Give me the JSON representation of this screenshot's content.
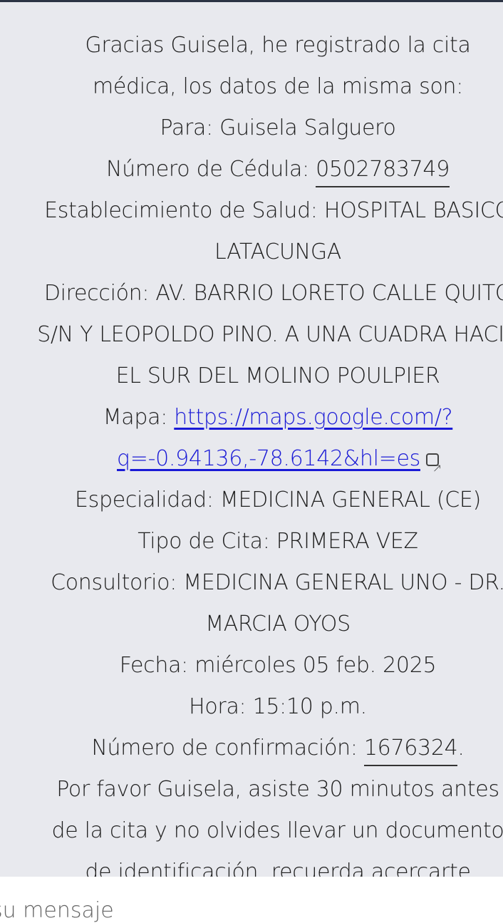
{
  "message": {
    "lines": [
      "Gracias Guisela, he registrado la cita",
      "médica, los datos de la misma son:",
      "Para: Guisela Salguero"
    ],
    "cedula_label": "Número de Cédula: ",
    "cedula_value": "0502783749",
    "lines2": [
      "Establecimiento de Salud: HOSPITAL BASICO",
      "LATACUNGA",
      "Dirección: AV. BARRIO LORETO CALLE QUITO",
      "S/N Y LEOPOLDO PINO. A UNA CUADRA HACIA",
      "EL SUR DEL MOLINO POULPIER"
    ],
    "map_label": "Mapa: ",
    "map_link_line1": "https://maps.google.com/?",
    "map_link_line2": "q=-0.94136,-78.6142&hl=es",
    "lines3": [
      "Especialidad: MEDICINA GENERAL (CE)",
      "Tipo de Cita: PRIMERA VEZ",
      "Consultorio: MEDICINA GENERAL UNO - DR.",
      "MARCIA OYOS",
      "Fecha: miércoles 05 feb. 2025",
      "Hora: 15:10 p.m."
    ],
    "confirm_label": "Número de confirmación: ",
    "confirm_value": "1676324",
    "confirm_end": ".",
    "lines4": [
      "Por favor Guisela, asiste 30 minutos antes",
      "de la cita y no olvides llevar un documento",
      "de identificación, recuerda acercarte"
    ]
  },
  "composer": {
    "placeholder": "su mensaje"
  }
}
